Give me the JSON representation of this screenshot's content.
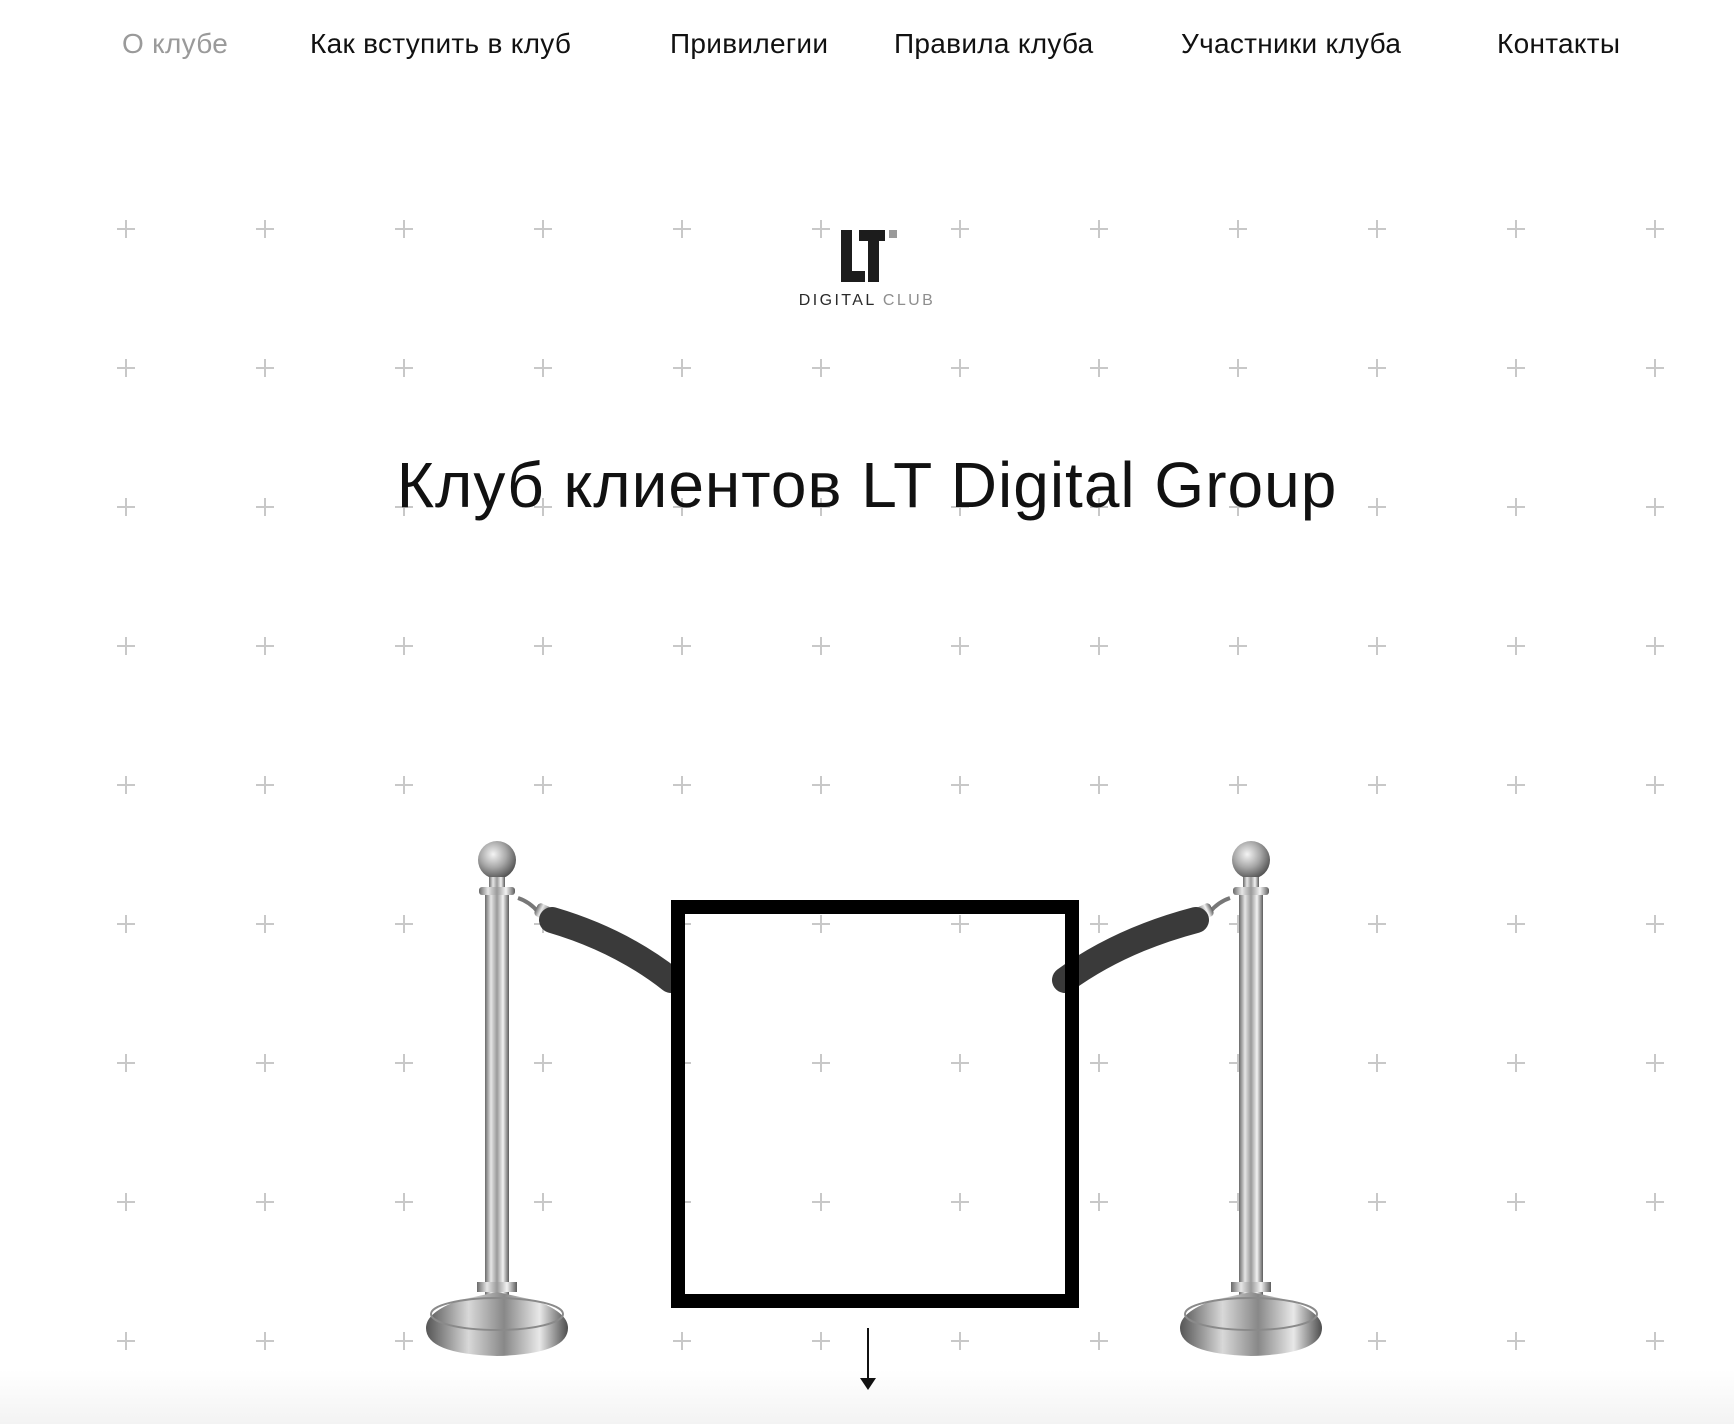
{
  "nav": {
    "items": [
      {
        "label": "О клубе",
        "active": true
      },
      {
        "label": "Как вступить в клуб",
        "active": false
      },
      {
        "label": "Привилегии",
        "active": false
      },
      {
        "label": "Правила клуба",
        "active": false
      },
      {
        "label": "Участники клуба",
        "active": false
      },
      {
        "label": "Контакты",
        "active": false
      }
    ]
  },
  "logo": {
    "mark": "LT",
    "caption_primary": "DIGITAL",
    "caption_secondary": "CLUB"
  },
  "hero": {
    "title": "Клуб клиентов LT Digital Group"
  },
  "icons": {
    "scroll": "arrow-down-icon",
    "background": "plus-grid"
  },
  "colors": {
    "text": "#111111",
    "nav_active": "#9a9a9a",
    "grid_plus": "#c8c8c8",
    "frame": "#000000",
    "rope": "#3a3a3a",
    "logo_accent": "#9a9a9a"
  }
}
